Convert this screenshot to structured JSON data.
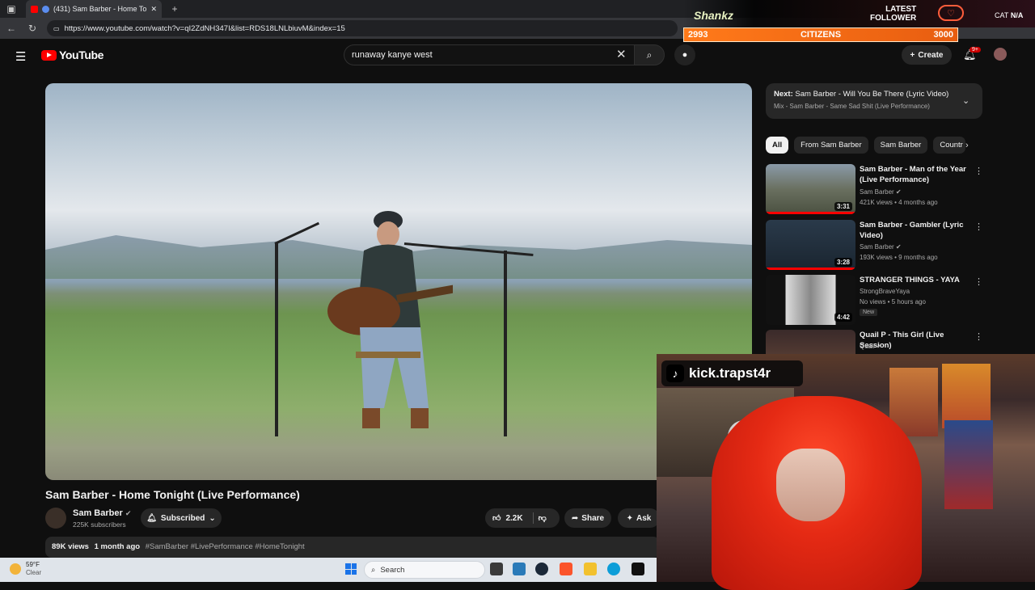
{
  "browser": {
    "tab_title": "(431) Sam Barber - Home To",
    "url": "https://www.youtube.com/watch?v=qI2ZdNH347I&list=RDS18LNLbiuvM&index=15"
  },
  "header": {
    "logo_text": "YouTube",
    "search_value": "runaway kanye west",
    "create_label": "Create",
    "notif_badge": "9+"
  },
  "video": {
    "title": "Sam Barber - Home Tonight (Live Performance)",
    "channel": "Sam Barber",
    "subscribers": "225K subscribers",
    "subscribed_label": "Subscribed",
    "likes": "2.2K",
    "share_label": "Share",
    "ask_label": "Ask",
    "views": "89K views",
    "age": "1 month ago",
    "tags": "#SamBarber #LivePerformance #HomeTonight"
  },
  "next": {
    "prefix": "Next:",
    "title": "Sam Barber - Will You Be There (Lyric Video)",
    "mix": "Mix - Sam Barber - Same Sad Shit (Live Performance)"
  },
  "chips": [
    "All",
    "From Sam Barber",
    "Sam Barber",
    "Countr"
  ],
  "recommendations": [
    {
      "title": "Sam Barber - Man of the Year (Live Performance)",
      "channel": "Sam Barber",
      "meta": "421K views • 4 months ago",
      "duration": "3:31",
      "progress": 1.0,
      "new": ""
    },
    {
      "title": "Sam Barber - Gambler (Lyric Video)",
      "channel": "Sam Barber",
      "meta": "193K views • 9 months ago",
      "duration": "3:28",
      "progress": 1.0,
      "new": ""
    },
    {
      "title": "STRANGER THINGS - YAYA",
      "channel": "StrongBraveYaya",
      "meta": "No views • 5 hours ago",
      "duration": "4:42",
      "progress": 0,
      "new": "New"
    },
    {
      "title": "Quail P - This Girl (Live Session)",
      "channel": "Quail",
      "meta": "",
      "duration": "",
      "progress": 0,
      "new": ""
    }
  ],
  "overlay": {
    "brand": "Shankz",
    "latest_line1": "LATEST",
    "latest_line2": "FOLLOWER",
    "cat": "CAT",
    "na": "N/A",
    "goal_current": "2993",
    "goal_label": "CITIZENS",
    "goal_target": "3000",
    "kick_handle": "kick.trapst4r"
  },
  "taskbar": {
    "temp": "59°F",
    "condition": "Clear",
    "search_label": "Search"
  },
  "colors": {
    "accent_red": "#ff0000",
    "overlay_orange": "#ff7a1a",
    "hoodie_red": "#e52a14"
  }
}
